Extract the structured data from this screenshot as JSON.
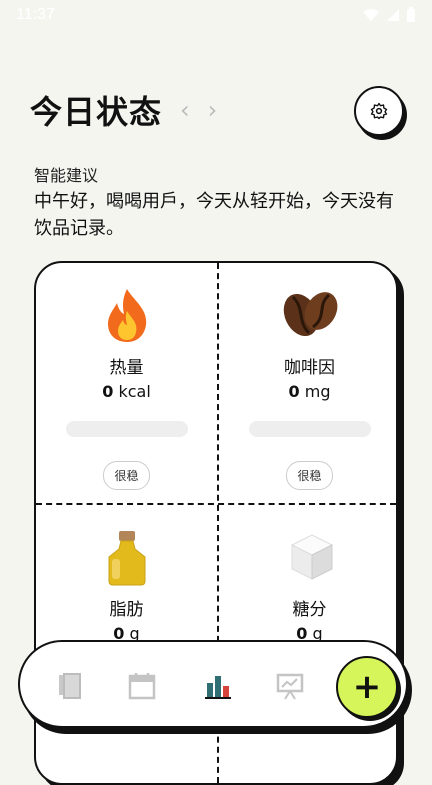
{
  "status_bar": {
    "time": "11:37"
  },
  "header": {
    "title": "今日状态",
    "prev": "‹",
    "next": "›"
  },
  "advice": {
    "title": "智能建议",
    "text": "中午好，喝喝用戶，今天从轻开始，今天没有饮品记录。"
  },
  "metrics": [
    {
      "label": "热量",
      "value": "0",
      "unit": "kcal",
      "badge": "很稳",
      "icon": "fire-icon"
    },
    {
      "label": "咖啡因",
      "value": "0",
      "unit": "mg",
      "badge": "很稳",
      "icon": "coffee-bean-icon"
    },
    {
      "label": "脂肪",
      "value": "0",
      "unit": "g",
      "icon": "oil-bottle-icon"
    },
    {
      "label": "糖分",
      "value": "0",
      "unit": "g",
      "icon": "sugar-cube-icon"
    }
  ],
  "nav": {
    "items": [
      "cup-icon",
      "calendar-icon",
      "bar-chart-icon",
      "presentation-icon"
    ],
    "active": "bar-chart-icon",
    "fab": "+"
  },
  "colors": {
    "accent": "#d6f55a",
    "active_nav": "#2f6f73"
  }
}
